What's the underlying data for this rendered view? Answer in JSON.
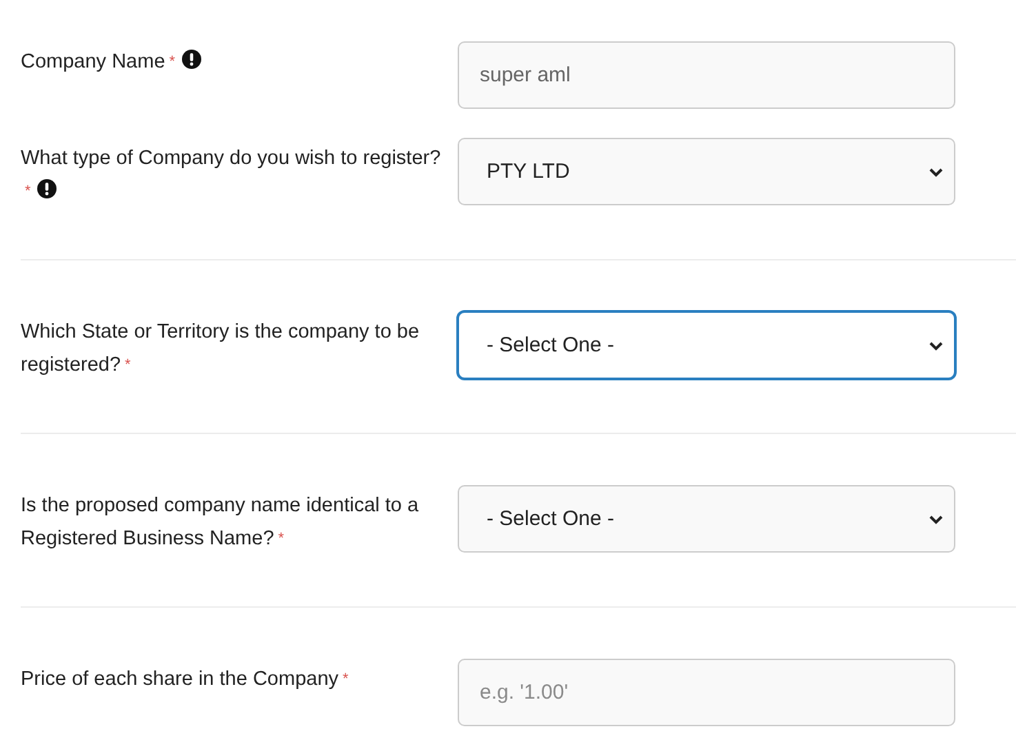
{
  "required_mark": "*",
  "sections": [
    {
      "fields": [
        {
          "label": "Company Name",
          "required": true,
          "info_icon": true,
          "kind": "input",
          "value": "super aml",
          "focused": false
        },
        {
          "label": "What type of Company do you wish to register?",
          "required": true,
          "info_icon": true,
          "kind": "select",
          "value": "PTY LTD",
          "focused": false
        }
      ]
    },
    {
      "fields": [
        {
          "label": "Which State or Territory is the company to be registered?",
          "required": true,
          "info_icon": false,
          "kind": "select",
          "value": "- Select One -",
          "focused": true
        }
      ]
    },
    {
      "fields": [
        {
          "label": "Is the proposed company name identical to a Registered Business Name?",
          "required": true,
          "info_icon": false,
          "kind": "select",
          "value": "- Select One -",
          "focused": false
        }
      ]
    },
    {
      "fields": [
        {
          "label": "Price of each share in the Company",
          "required": true,
          "info_icon": false,
          "kind": "input",
          "placeholder": "e.g. '1.00'",
          "focused": false
        }
      ]
    }
  ]
}
